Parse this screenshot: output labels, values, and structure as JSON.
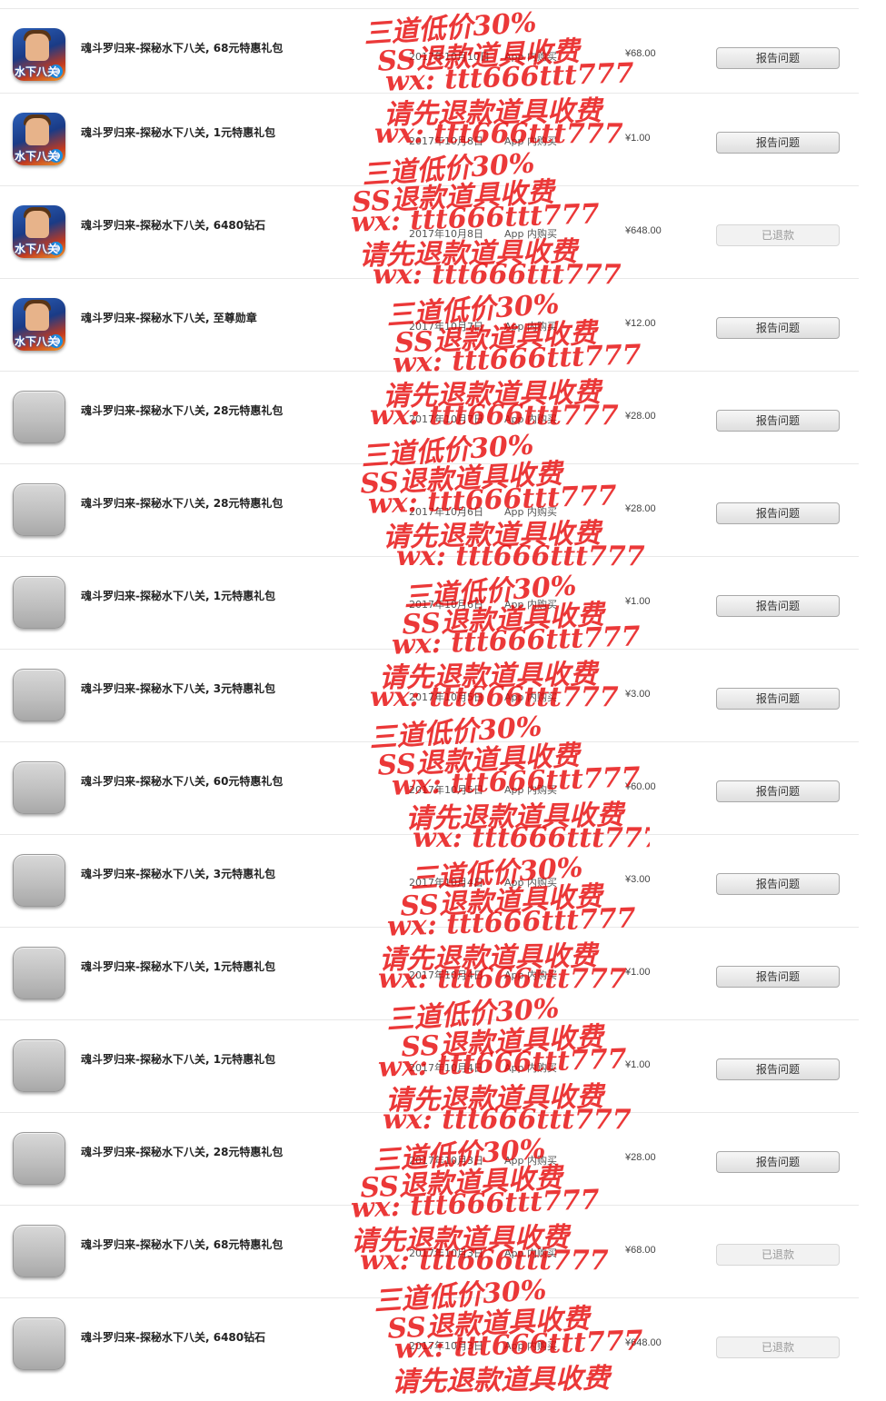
{
  "rows": [
    {
      "icon": "game-icon",
      "title": "魂斗罗归来-探秘水下八关, 68元特惠礼包",
      "date": "2017年10月10日",
      "type": "App 内购买",
      "price": "¥68.00",
      "action": "报告问题",
      "status": "report"
    },
    {
      "icon": "game-icon",
      "title": "魂斗罗归来-探秘水下八关, 1元特惠礼包",
      "date": "2017年10月8日",
      "type": "App 内购买",
      "price": "¥1.00",
      "action": "报告问题",
      "status": "report"
    },
    {
      "icon": "game-icon",
      "title": "魂斗罗归来-探秘水下八关, 6480钻石",
      "date": "2017年10月8日",
      "type": "App 内购买",
      "price": "¥648.00",
      "action": "已退款",
      "status": "refunded"
    },
    {
      "icon": "game-icon",
      "title": "魂斗罗归来-探秘水下八关, 至尊勋章",
      "date": "2017年10月7日",
      "type": "App 内购买",
      "price": "¥12.00",
      "action": "报告问题",
      "status": "report"
    },
    {
      "icon": "blank-app-icon",
      "title": "魂斗罗归来-探秘水下八关, 28元特惠礼包",
      "date": "2017年10月7日",
      "type": "App 内购买",
      "price": "¥28.00",
      "action": "报告问题",
      "status": "report"
    },
    {
      "icon": "blank-app-icon",
      "title": "魂斗罗归来-探秘水下八关, 28元特惠礼包",
      "date": "2017年10月6日",
      "type": "App 内购买",
      "price": "¥28.00",
      "action": "报告问题",
      "status": "report"
    },
    {
      "icon": "blank-app-icon",
      "title": "魂斗罗归来-探秘水下八关, 1元特惠礼包",
      "date": "2017年10月6日",
      "type": "App 内购买",
      "price": "¥1.00",
      "action": "报告问题",
      "status": "report"
    },
    {
      "icon": "blank-app-icon",
      "title": "魂斗罗归来-探秘水下八关, 3元特惠礼包",
      "date": "2017年10月5日",
      "type": "App 内购买",
      "price": "¥3.00",
      "action": "报告问题",
      "status": "report"
    },
    {
      "icon": "blank-app-icon",
      "title": "魂斗罗归来-探秘水下八关, 60元特惠礼包",
      "date": "2017年10月5日",
      "type": "App 内购买",
      "price": "¥60.00",
      "action": "报告问题",
      "status": "report"
    },
    {
      "icon": "blank-app-icon",
      "title": "魂斗罗归来-探秘水下八关, 3元特惠礼包",
      "date": "2017年10月4日",
      "type": "App 内购买",
      "price": "¥3.00",
      "action": "报告问题",
      "status": "report"
    },
    {
      "icon": "blank-app-icon",
      "title": "魂斗罗归来-探秘水下八关, 1元特惠礼包",
      "date": "2017年10月4日",
      "type": "App 内购买",
      "price": "¥1.00",
      "action": "报告问题",
      "status": "report"
    },
    {
      "icon": "blank-app-icon",
      "title": "魂斗罗归来-探秘水下八关, 1元特惠礼包",
      "date": "2017年10月4日",
      "type": "App 内购买",
      "price": "¥1.00",
      "action": "报告问题",
      "status": "report"
    },
    {
      "icon": "blank-app-icon",
      "title": "魂斗罗归来-探秘水下八关, 28元特惠礼包",
      "date": "2017年10月3日",
      "type": "App 内购买",
      "price": "¥28.00",
      "action": "报告问题",
      "status": "report"
    },
    {
      "icon": "blank-app-icon",
      "title": "魂斗罗归来-探秘水下八关, 68元特惠礼包",
      "date": "2017年10月3日",
      "type": "App 内购买",
      "price": "¥68.00",
      "action": "已退款",
      "status": "refunded"
    },
    {
      "icon": "blank-app-icon",
      "title": "魂斗罗归来-探秘水下八关, 6480钻石",
      "date": "2017年10月3日",
      "type": "App 内购买",
      "price": "¥648.00",
      "action": "已退款",
      "status": "refunded"
    }
  ],
  "game_icon_label": "水下八关",
  "watermark": {
    "lines": [
      "三道低价30%",
      "SS退款道具收费",
      "wx: ttt666ttt777",
      "请先退款道具收费",
      "wx: ttt666ttt777"
    ]
  }
}
